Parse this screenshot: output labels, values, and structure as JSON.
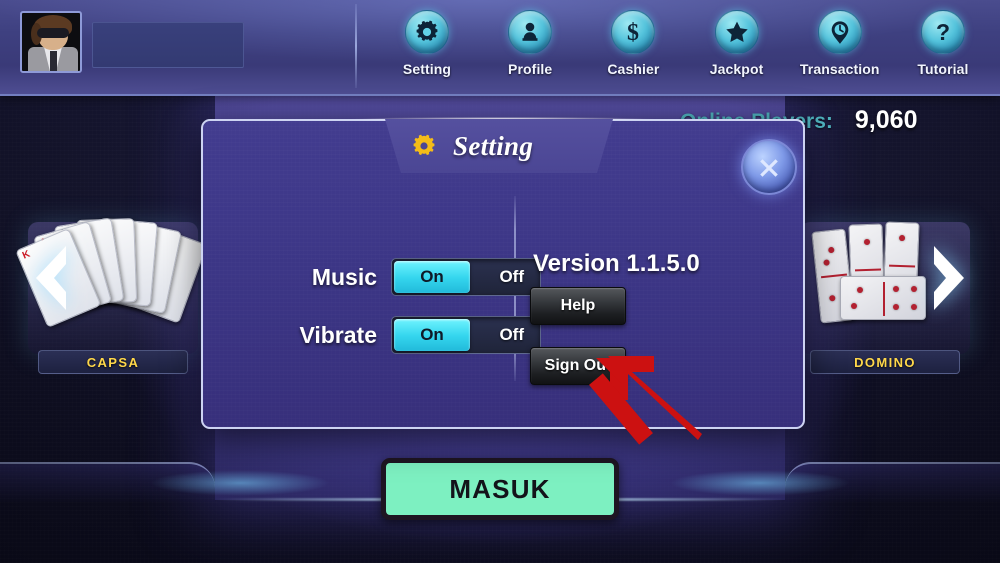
{
  "header": {
    "avatar_alt": "player-avatar",
    "nameplate_value": "",
    "nav": [
      {
        "label": "Setting",
        "icon": "gear-icon"
      },
      {
        "label": "Profile",
        "icon": "person-icon"
      },
      {
        "label": "Cashier",
        "icon": "dollar-icon"
      },
      {
        "label": "Jackpot",
        "icon": "star-icon"
      },
      {
        "label": "Transaction",
        "icon": "clock-pin-icon"
      },
      {
        "label": "Tutorial",
        "icon": "question-mark-icon"
      }
    ]
  },
  "status": {
    "online_players_label": "Online Players:",
    "online_players_count": "9,060"
  },
  "games": {
    "left": {
      "label": "CAPSA",
      "icon": "playing-cards-fan"
    },
    "right": {
      "label": "DOMINO",
      "icon": "domino-tiles"
    },
    "prev_arrow": "chevron-left-icon",
    "next_arrow": "chevron-right-icon"
  },
  "enter_button": {
    "label": "MASUK"
  },
  "dialog": {
    "title": "Setting",
    "title_icon": "gear-icon",
    "close_icon": "close-x-icon",
    "settings": [
      {
        "label": "Music",
        "on_label": "On",
        "off_label": "Off",
        "value": "On"
      },
      {
        "label": "Vibrate",
        "on_label": "On",
        "off_label": "Off",
        "value": "On"
      }
    ],
    "version_text": "Version 1.1.5.0",
    "help_label": "Help",
    "sign_out_label": "Sign Out"
  },
  "annotation": {
    "arrow": "red-arrow-pointing-to-sign-out",
    "color": "#cc1111"
  },
  "colors": {
    "dialog_bg": "#3c3686",
    "accent_cyan": "#35d6ee",
    "label_gold": "#ffd84a",
    "masuk_green": "#7df0c1",
    "online_teal": "#4fb3bf"
  }
}
